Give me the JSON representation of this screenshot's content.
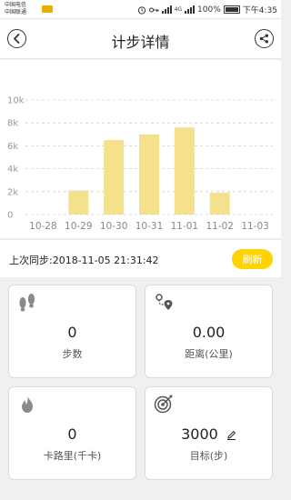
{
  "status_bar": {
    "carrier_line1": "中国电信",
    "carrier_line2": "中国联通",
    "network": "4G",
    "battery": "100%",
    "time": "下午4:35"
  },
  "header": {
    "title": "计步详情",
    "back_icon": "back-arrow-icon",
    "share_icon": "share-icon"
  },
  "chart_data": {
    "type": "bar",
    "categories": [
      "10-28",
      "10-29",
      "10-30",
      "10-31",
      "11-01",
      "11-02",
      "11-03"
    ],
    "values": [
      0,
      2100,
      6500,
      7000,
      7600,
      1900,
      0
    ],
    "y_ticks": [
      "0",
      "2k",
      "4k",
      "6k",
      "8k",
      "10k"
    ],
    "ylim": [
      0,
      10000
    ],
    "bar_color": "#f5e08c",
    "grid": true
  },
  "sync": {
    "label": "上次同步:2018-11-05 21:31:42",
    "refresh_label": "刷新"
  },
  "cards": [
    {
      "icon": "footprints-icon",
      "value": "0",
      "label": "步数"
    },
    {
      "icon": "location-route-icon",
      "value": "0.00",
      "label": "距离(公里)"
    },
    {
      "icon": "flame-icon",
      "value": "0",
      "label": "卡路里(千卡)"
    },
    {
      "icon": "target-icon",
      "value": "3000",
      "label": "目标(步)"
    }
  ],
  "colors": {
    "accent": "#ffd400",
    "bar": "#f5e08c",
    "background": "#f0f0f0"
  }
}
